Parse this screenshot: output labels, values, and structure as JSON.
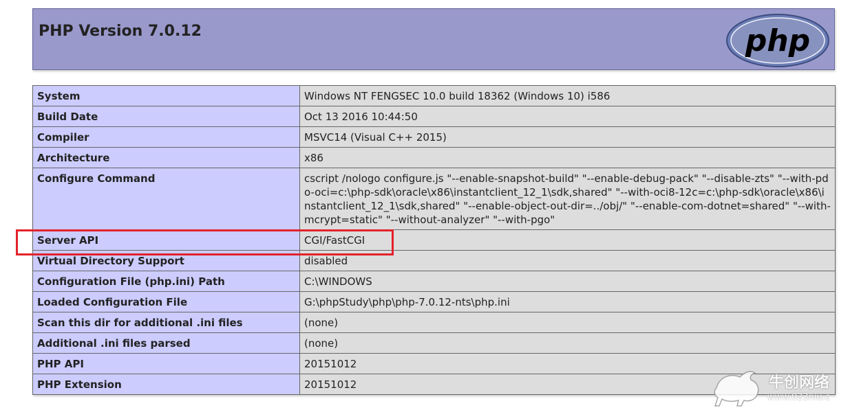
{
  "header": {
    "title": "PHP Version 7.0.12",
    "logo_text": "php"
  },
  "rows": [
    {
      "key": "System",
      "value": "Windows NT FENGSEC 10.0 build 18362 (Windows 10) i586"
    },
    {
      "key": "Build Date",
      "value": "Oct 13 2016 10:44:50"
    },
    {
      "key": "Compiler",
      "value": "MSVC14 (Visual C++ 2015)"
    },
    {
      "key": "Architecture",
      "value": "x86"
    },
    {
      "key": "Configure Command",
      "value": "cscript /nologo configure.js \"--enable-snapshot-build\" \"--enable-debug-pack\" \"--disable-zts\" \"--with-pdo-oci=c:\\php-sdk\\oracle\\x86\\instantclient_12_1\\sdk,shared\" \"--with-oci8-12c=c:\\php-sdk\\oracle\\x86\\instantclient_12_1\\sdk,shared\" \"--enable-object-out-dir=../obj/\" \"--enable-com-dotnet=shared\" \"--with-mcrypt=static\" \"--without-analyzer\" \"--with-pgo\""
    },
    {
      "key": "Server API",
      "value": "CGI/FastCGI"
    },
    {
      "key": "Virtual Directory Support",
      "value": "disabled"
    },
    {
      "key": "Configuration File (php.ini) Path",
      "value": "C:\\WINDOWS"
    },
    {
      "key": "Loaded Configuration File",
      "value": "G:\\phpStudy\\php\\php-7.0.12-nts\\php.ini"
    },
    {
      "key": "Scan this dir for additional .ini files",
      "value": "(none)"
    },
    {
      "key": "Additional .ini files parsed",
      "value": "(none)"
    },
    {
      "key": "PHP API",
      "value": "20151012"
    },
    {
      "key": "PHP Extension",
      "value": "20151012"
    }
  ],
  "watermark": {
    "title": "牛创网络",
    "url": "www.023niu.c"
  },
  "colors": {
    "header_bg": "#9999cc",
    "key_bg": "#ccccff",
    "value_bg": "#dddddd",
    "highlight": "#e3222b"
  }
}
